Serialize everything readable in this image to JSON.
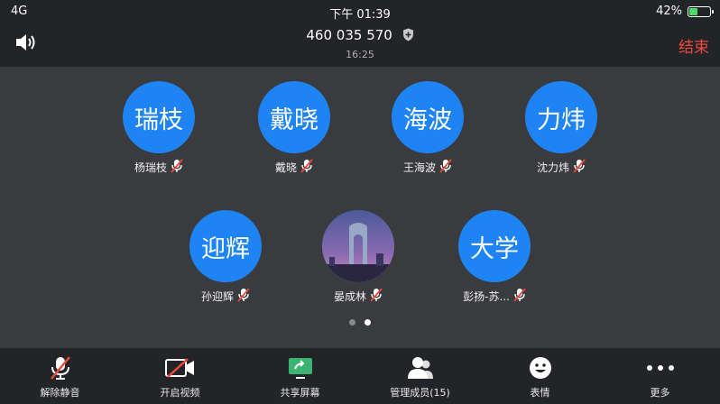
{
  "status": {
    "signal": "4G",
    "time": "下午 01:39",
    "battery_percent": "42%",
    "battery_level": 0.42
  },
  "header": {
    "meeting_id": "460 035 570",
    "duration": "16:25",
    "end_label": "结束"
  },
  "participants": [
    {
      "avatar_text": "瑞枝",
      "name": "杨瑞枝",
      "muted": true
    },
    {
      "avatar_text": "戴晓",
      "name": "戴晓",
      "muted": true
    },
    {
      "avatar_text": "海波",
      "name": "王海波",
      "muted": true
    },
    {
      "avatar_text": "力炜",
      "name": "沈力炜",
      "muted": true
    },
    {
      "avatar_text": "迎辉",
      "name": "孙迎辉",
      "muted": true
    },
    {
      "avatar_text": "",
      "avatar_icon": "city-photo",
      "name": "晏成林",
      "muted": true
    },
    {
      "avatar_text": "大学",
      "name": "彭扬-苏...",
      "muted": true
    }
  ],
  "pager": {
    "count": 2,
    "active": 2
  },
  "toolbar": {
    "unmute": "解除静音",
    "video": "开启视频",
    "share": "共享屏幕",
    "members": "管理成员(15)",
    "emoji": "表情",
    "more": "更多"
  },
  "colors": {
    "avatar_blue": "#1e84f3",
    "end_red": "#f04a3e",
    "mute_red": "#e84b3c",
    "share_green": "#3cb371"
  }
}
